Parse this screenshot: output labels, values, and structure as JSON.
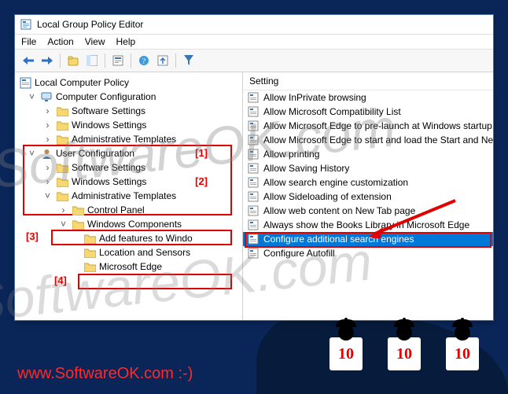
{
  "window": {
    "title": "Local Group Policy Editor"
  },
  "menubar": {
    "file": "File",
    "action": "Action",
    "view": "View",
    "help": "Help"
  },
  "tree": {
    "root": "Local Computer Policy",
    "compConfig": "Computer Configuration",
    "cc_soft": "Software Settings",
    "cc_win": "Windows Settings",
    "cc_adm": "Administrative Templates",
    "userConfig": "User Configuration",
    "uc_soft": "Software Settings",
    "uc_win": "Windows Settings",
    "uc_adm": "Administrative Templates",
    "cpanel": "Control Panel",
    "wcomp": "Windows Components",
    "addfeat": "Add features to Windo",
    "locsens": "Location and Sensors",
    "edge": "Microsoft Edge"
  },
  "annotations": {
    "a1": "[1]",
    "a2": "[2]",
    "a3": "[3]",
    "a4": "[4]"
  },
  "list": {
    "header": "Setting",
    "items": [
      "Allow InPrivate browsing",
      "Allow Microsoft Compatibility List",
      "Allow Microsoft Edge to pre-launch at Windows startup, wh…",
      "Allow Microsoft Edge to start and load the Start and New Ta…",
      "Allow printing",
      "Allow Saving History",
      "Allow search engine customization",
      "Allow Sideloading of extension",
      "Allow web content on New Tab page",
      "Always show the Books Library in Microsoft Edge",
      "Configure additional search engines",
      "Configure Autofill"
    ],
    "selectedIndex": 10
  },
  "judges": {
    "score": "10"
  },
  "footer": {
    "url": "www.SoftwareOK.com :-)"
  },
  "watermark": {
    "text": "SoftwareOK.com"
  }
}
